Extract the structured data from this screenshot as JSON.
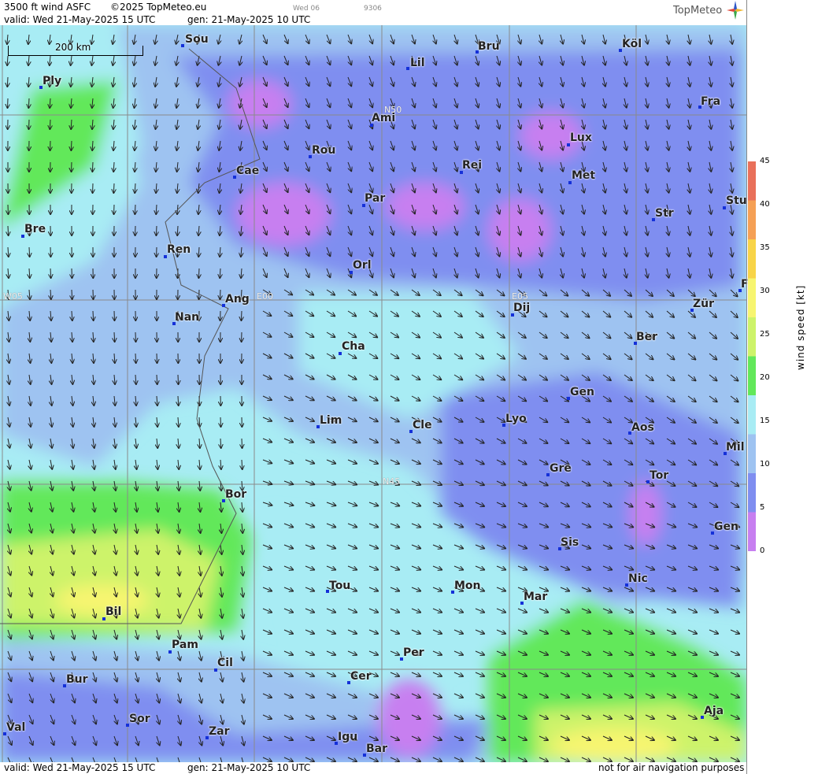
{
  "header": {
    "product": "3500 ft wind ASFC",
    "copyright": "©2025 TopMeteo.eu",
    "day_code": "Wed 06",
    "code": "9306",
    "valid": "valid:  Wed  21-May-2025  15 UTC",
    "gen": "gen: 21-May-2025 10 UTC"
  },
  "logo": {
    "text": "TopMeteo",
    "icon": "compass-star-icon"
  },
  "scale_bar": {
    "label": "200 km"
  },
  "grid_labels": [
    "N50",
    "W05",
    "E00",
    "E05",
    "N45"
  ],
  "cities": [
    "Sou",
    "Bru",
    "Köl",
    "Lil",
    "Ply",
    "Fra",
    "Ami",
    "Lux",
    "Rou",
    "Cae",
    "Rei",
    "Met",
    "Par",
    "Stu",
    "Bre",
    "Str",
    "Ren",
    "Orl",
    "F",
    "Ang",
    "Dij",
    "Zür",
    "Nan",
    "Ber",
    "Cha",
    "Gen",
    "Lim",
    "Cle",
    "Lyo",
    "Aos",
    "Mil",
    "Gre",
    "Tor",
    "Bor",
    "Gen",
    "Sis",
    "Nic",
    "Tou",
    "Mon",
    "Mar",
    "Bil",
    "Pam",
    "Per",
    "Cil",
    "Bur",
    "Cer",
    "Aja",
    "Sor",
    "Val",
    "Zar",
    "Igu",
    "Bar"
  ],
  "legend": {
    "title": "wind  speed  [kt]",
    "ticks": [
      "45",
      "40",
      "35",
      "30",
      "25",
      "20",
      "15",
      "10",
      "5",
      "0"
    ],
    "colors": [
      "#e9705a",
      "#f5a055",
      "#f8d448",
      "#f7f570",
      "#cdf36a",
      "#62e85a",
      "#a8ecf4",
      "#9ec3f1",
      "#7f8ef0",
      "#c77ff0"
    ]
  },
  "footer": {
    "valid": "valid:  Wed  21-May-2025  15 UTC",
    "gen": "gen: 21-May-2025 10 UTC",
    "disclaimer": "not for air navigation purposes"
  }
}
